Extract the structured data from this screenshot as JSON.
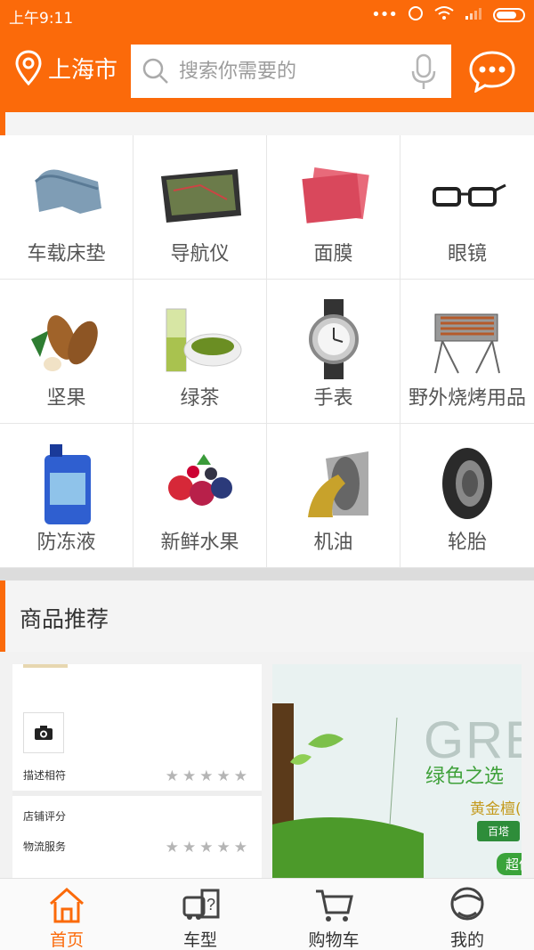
{
  "status_bar": {
    "time": "上午9:11"
  },
  "header": {
    "city": "上海市",
    "search_placeholder": "搜索你需要的",
    "icons": [
      "location-pin-icon",
      "search-icon",
      "microphone-icon",
      "chat-bubble-icon"
    ]
  },
  "categories": [
    {
      "label": "车载床垫",
      "icon": "car-mattress"
    },
    {
      "label": "导航仪",
      "icon": "gps-navigator"
    },
    {
      "label": "面膜",
      "icon": "face-mask"
    },
    {
      "label": "眼镜",
      "icon": "glasses"
    },
    {
      "label": "坚果",
      "icon": "nuts"
    },
    {
      "label": "绿茶",
      "icon": "green-tea"
    },
    {
      "label": "手表",
      "icon": "watch"
    },
    {
      "label": "野外烧烤用品",
      "icon": "bbq-grill"
    },
    {
      "label": "防冻液",
      "icon": "antifreeze"
    },
    {
      "label": "新鲜水果",
      "icon": "fruit"
    },
    {
      "label": "机油",
      "icon": "engine-oil"
    },
    {
      "label": "轮胎",
      "icon": "tire"
    }
  ],
  "recommend": {
    "title": "商品推荐",
    "left_card": {
      "rows": [
        {
          "label": "描述相符",
          "stars": "★★★★★"
        },
        {
          "label": "店铺评分",
          "stars": ""
        },
        {
          "label": "物流服务",
          "stars": "★★★★★"
        }
      ]
    },
    "right_card": {
      "big_text": "GRE",
      "title": "绿色之选",
      "subtitle": "黄金檀(",
      "tag": "百塔",
      "button": "超值"
    }
  },
  "bottom_nav": [
    {
      "label": "首页",
      "icon": "home-icon",
      "active": true
    },
    {
      "label": "车型",
      "icon": "car-model-icon",
      "active": false
    },
    {
      "label": "购物车",
      "icon": "cart-icon",
      "active": false
    },
    {
      "label": "我的",
      "icon": "profile-icon",
      "active": false
    }
  ],
  "colors": {
    "accent": "#fb6a0a",
    "grid_border": "#e6e6e6"
  }
}
